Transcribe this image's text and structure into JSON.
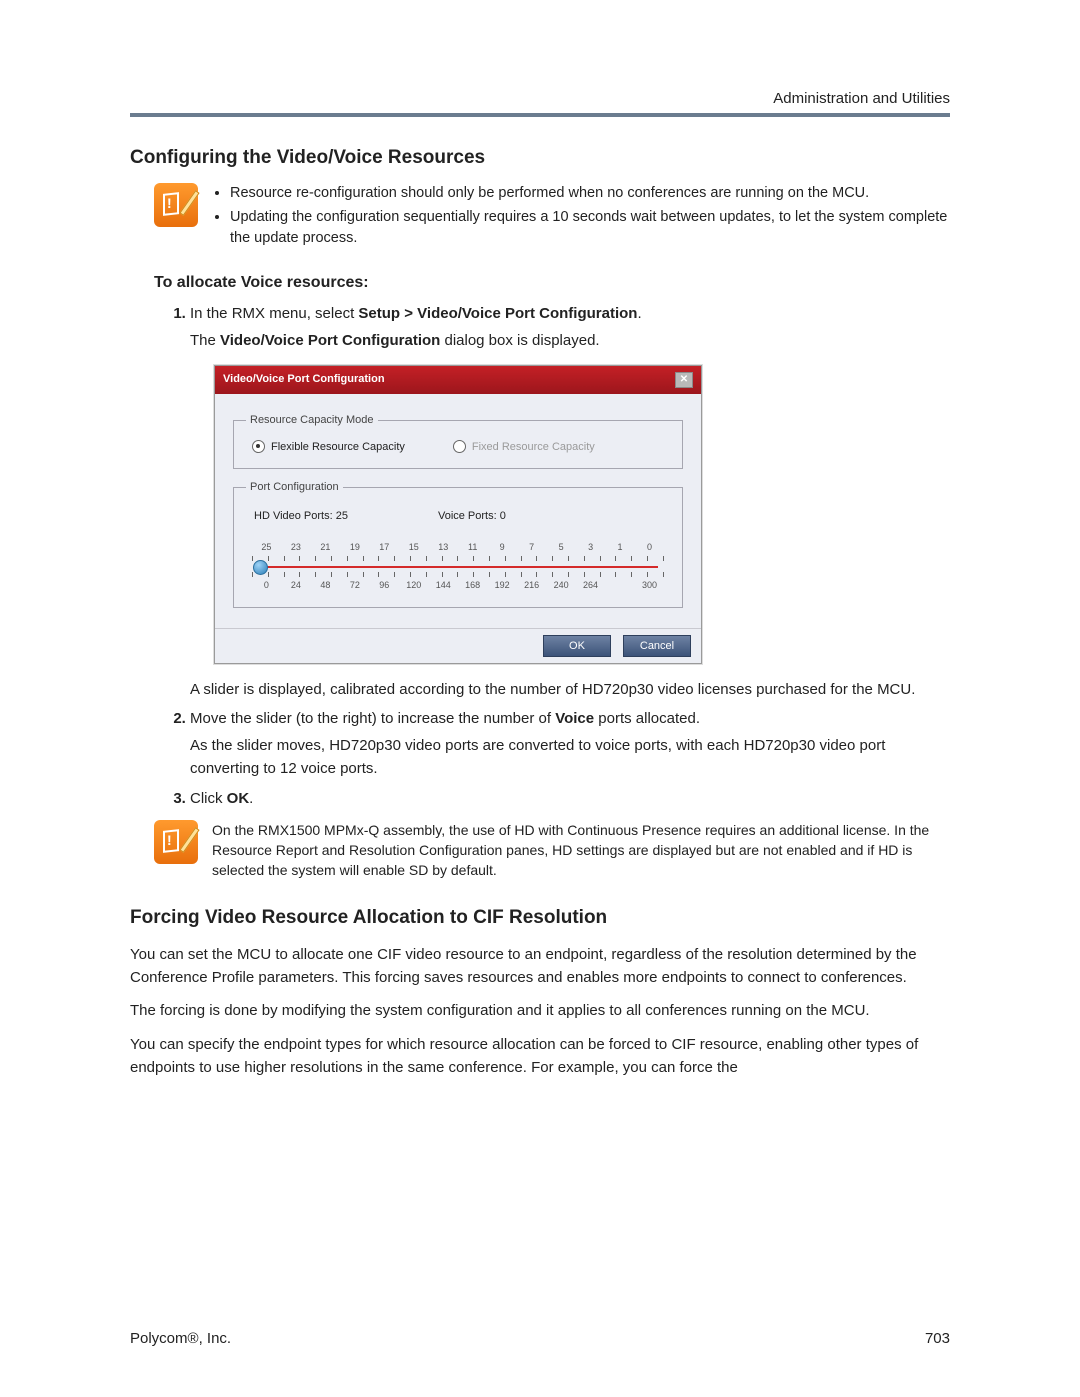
{
  "header": {
    "section": "Administration and Utilities"
  },
  "h1": "Configuring the Video/Voice Resources",
  "note1": {
    "items": [
      "Resource re-configuration should only be performed when no conferences are running on the MCU.",
      "Updating the configuration sequentially requires a 10 seconds wait between updates, to let the system complete the update process."
    ]
  },
  "h3a": "To allocate Voice resources:",
  "step1": {
    "lead": "In the RMX menu, select ",
    "bold": "Setup > Video/Voice Port Configuration",
    "tail": ".",
    "sub_a": "The ",
    "sub_b": "Video/Voice Port Configuration",
    "sub_c": " dialog box is displayed."
  },
  "dialog": {
    "title": "Video/Voice Port Configuration",
    "legend1": "Resource Capacity Mode",
    "radio_flex": "Flexible Resource Capacity",
    "radio_fixed": "Fixed Resource Capacity",
    "legend2": "Port Configuration",
    "hd_label": "HD Video Ports: 25",
    "voice_label": "Voice Ports: 0",
    "top_scale": [
      "25",
      "23",
      "21",
      "19",
      "17",
      "15",
      "13",
      "11",
      "9",
      "7",
      "5",
      "3",
      "1",
      "0"
    ],
    "bottom_scale": [
      "0",
      "24",
      "48",
      "72",
      "96",
      "120",
      "144",
      "168",
      "192",
      "216",
      "240",
      "264",
      "",
      "300"
    ],
    "ok": "OK",
    "cancel": "Cancel"
  },
  "slider_caption": "A slider is displayed, calibrated according to the number of HD720p30 video licenses purchased for the MCU.",
  "step2": {
    "a": "Move the slider (to the right) to increase the number of ",
    "b": "Voice",
    "c": " ports allocated.",
    "sub": "As the slider moves, HD720p30 video ports are converted to voice ports, with each HD720p30 video port converting to 12 voice ports."
  },
  "step3": {
    "a": "Click ",
    "b": "OK",
    "c": "."
  },
  "note2": "On the RMX1500 MPMx-Q assembly, the use of HD with Continuous Presence requires an additional license. In the Resource Report and Resolution Configuration panes, HD settings are displayed but are not enabled and if HD is selected the system will enable SD by default.",
  "h2b": "Forcing Video Resource Allocation to CIF Resolution",
  "p1": "You can set the MCU to allocate one CIF video resource to an endpoint, regardless of the resolution determined by the Conference Profile parameters. This forcing saves resources and enables more endpoints to connect to conferences.",
  "p2": "The forcing is done by modifying the system configuration and it applies to all conferences running on the MCU.",
  "p3": "You can specify the endpoint types for which resource allocation can be forced to CIF resource, enabling other types of endpoints to use higher resolutions in the same conference. For example, you can force the",
  "footer": {
    "left": "Polycom®, Inc.",
    "right": "703"
  }
}
